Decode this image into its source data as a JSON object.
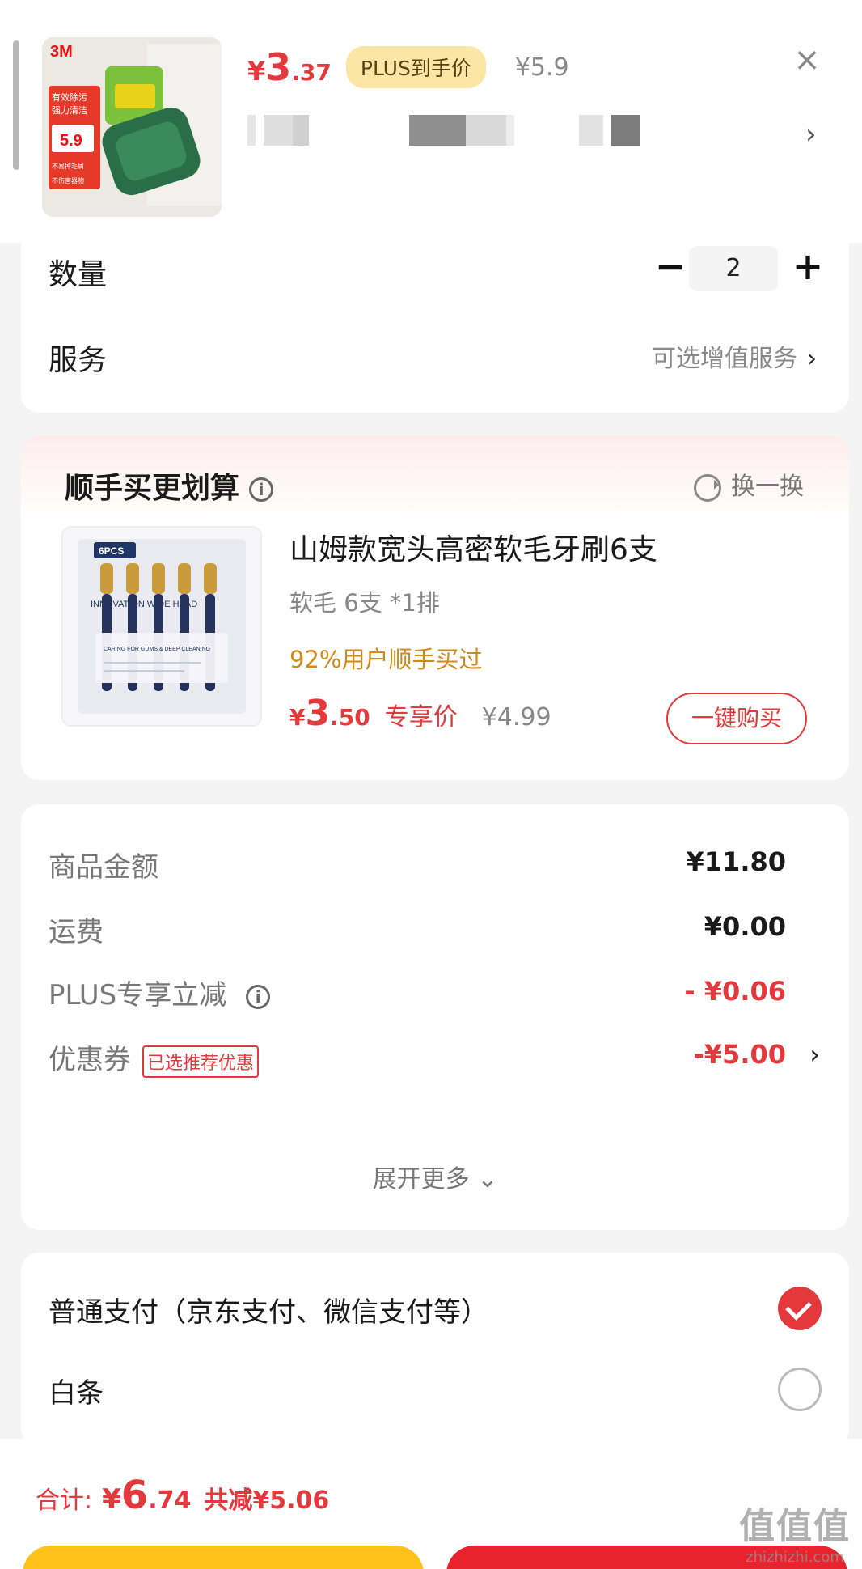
{
  "header": {
    "price_symbol": "¥",
    "price_int": "3",
    "price_dec": ".37",
    "plus_badge": "PLUS到手价",
    "original_price": "¥5.9",
    "close_icon": "×",
    "spec_chevron": "›"
  },
  "product_image_text": {
    "brand": "3M",
    "promo_line1": "有效除污",
    "promo_line2": "强力清洁",
    "price_tag": "5.9",
    "feature1": "不易掉毛屑",
    "feature2": "不伤害器物"
  },
  "quantity": {
    "label": "数量",
    "minus": "−",
    "value": "2",
    "plus": "+"
  },
  "service": {
    "label": "服务",
    "hint": "可选增值服务",
    "chevron": "›"
  },
  "bundle": {
    "title": "顺手买更划算",
    "info_icon": "i",
    "refresh_label": "换一换",
    "item": {
      "name": "山姆款宽头高密软毛牙刷6支",
      "spec": "软毛 6支 *1排",
      "bought_pct": "92%用户顺手买过",
      "price_symbol": "¥",
      "price_int": "3",
      "price_dec": ".50",
      "exclusive_label": "专享价",
      "original_price": "¥4.99",
      "buy_button": "一键购买",
      "pack_label": "6PCS",
      "pack_band": "INNOVATION WIDE HEAD",
      "pack_card": "CARING FOR GUMS & DEEP CLEANING"
    }
  },
  "summary": {
    "rows": [
      {
        "label": "商品金额",
        "value": "¥11.80"
      },
      {
        "label": "运费",
        "value": "¥0.00"
      },
      {
        "label": "PLUS专享立减",
        "value": "- ¥0.06"
      },
      {
        "label": "优惠券",
        "value": "-¥5.00"
      }
    ],
    "coupon_tag": "已选推荐优惠",
    "info_icon": "i",
    "coupon_chevron": "›",
    "expand_label": "展开更多 ⌄"
  },
  "payment": {
    "options": [
      {
        "label": "普通支付（京东支付、微信支付等）",
        "selected": true
      },
      {
        "label": "白条",
        "selected": false
      }
    ]
  },
  "bottom": {
    "total_label": "合计:",
    "total_symbol": "¥",
    "total_int": "6",
    "total_dec": ".74",
    "total_saved": "共减¥5.06"
  },
  "watermark": {
    "logo": "值值值",
    "url": "zhizhizhi.com"
  },
  "colors": {
    "accent_red": "#e4393c",
    "plus_gold": "#fbe6a6",
    "pct_orange": "#d08a1a",
    "buy_yellow": "#ffc21a"
  }
}
